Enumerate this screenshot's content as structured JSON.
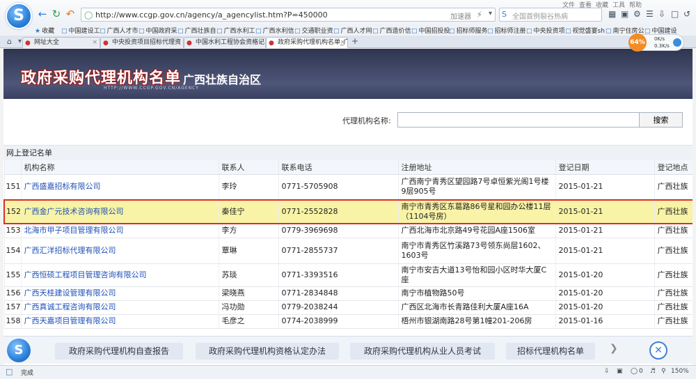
{
  "browser": {
    "logo_glyph": "S",
    "url": "http://www.ccgp.gov.cn/agency/a_agencylist.htm?P=450000",
    "accelerator": "加速器",
    "search_placeholder": "全国首例裂谷热病",
    "menu_items": [
      "文件",
      "查看",
      "收藏",
      "工具",
      "帮助"
    ],
    "bookmarks": [
      "收藏",
      "中国建设工",
      "广西人才市",
      "中国政府采",
      "广西壮族自",
      "广西水利工",
      "广西水利信",
      "交通职业资",
      "广西人才网",
      "广西造价信",
      "中国招投投",
      "招标师服务",
      "招标师注册",
      "中央投资项",
      "视觉盛宴sh",
      "南宁住房公",
      "中国建设"
    ],
    "tabs": [
      {
        "label": "网址大全",
        "active": false
      },
      {
        "label": "中央投资项目招标代理资",
        "active": false
      },
      {
        "label": "中国水利工程协会资格记",
        "active": false
      },
      {
        "label": "政府采购代理机构名单_广",
        "active": true
      }
    ],
    "speed_pct": "64%",
    "speed_up": "0K/s",
    "speed_down": "0.3K/s"
  },
  "banner": {
    "title": "政府采购代理机构名单",
    "region": "广西壮族自治区",
    "subtitle": "HTTP://WWW.CCGP.GOV.CN/AGENCY"
  },
  "search": {
    "label": "代理机构名称:",
    "value": "",
    "button": "搜索"
  },
  "section_title": "网上登记名单",
  "table": {
    "headers": [
      "",
      "机构名称",
      "联系人",
      "联系电话",
      "注册地址",
      "登记日期",
      "登记地点"
    ],
    "rows": [
      {
        "no": "151",
        "name": "广西盛嘉招标有限公司",
        "contact": "李玲",
        "phone": "0771-5705908",
        "address": "广西南宁青秀区望园路7号卓恒紫光阁1号楼9层905号",
        "date": "2015-01-21",
        "place": "广西壮族"
      },
      {
        "no": "152",
        "name": "广西金广元技术咨询有限公司",
        "contact": "秦佳宁",
        "phone": "0771-2552828",
        "address": "南宁市青秀区东葛路86号星和园办公楼11层（1104号房）",
        "date": "2015-01-21",
        "place": "广西壮族"
      },
      {
        "no": "153",
        "name": "北海市甲子项目管理有限公司",
        "contact": "李方",
        "phone": "0779-3969698",
        "address": "广西北海市北京路49号花园A座1506室",
        "date": "2015-01-21",
        "place": "广西壮族"
      },
      {
        "no": "154",
        "name": "广西汇洋招标代理有限公司",
        "contact": "覃琳",
        "phone": "0771-2855737",
        "address": "南宁市青秀区竹溪路73号领东尚层1602、1603号",
        "date": "2015-01-21",
        "place": "广西壮族"
      },
      {
        "no": "155",
        "name": "广西恒硕工程项目管理咨询有限公司",
        "contact": "苏琰",
        "phone": "0771-3393516",
        "address": "南宁市安吉大道13号怡和园小区时华大厦C座",
        "date": "2015-01-20",
        "place": "广西壮族"
      },
      {
        "no": "156",
        "name": "广西天桂建设管理有限公司",
        "contact": "梁晓燕",
        "phone": "0771-2834848",
        "address": "南宁市植物路50号",
        "date": "2015-01-20",
        "place": "广西壮族"
      },
      {
        "no": "157",
        "name": "广西真诚工程咨询有限公司",
        "contact": "冯功勋",
        "phone": "0779-2038244",
        "address": "广西区北海市长青路佳利大厦A座16A",
        "date": "2015-01-20",
        "place": "广西壮族"
      },
      {
        "no": "158",
        "name": "广西天嘉项目管理有限公司",
        "contact": "毛彦之",
        "phone": "0774-2038999",
        "address": "梧州市银湖南路28号第1幢201-206房",
        "date": "2015-01-16",
        "place": "广西壮族"
      }
    ]
  },
  "bottom_bar": {
    "links": [
      "政府采购代理机构自查报告",
      "政府采购代理机构资格认定办法",
      "政府采购代理机构从业人员考试",
      "招标代理机构名单"
    ]
  },
  "status": {
    "text": "完成",
    "counter": "0",
    "zoom": "150%"
  }
}
